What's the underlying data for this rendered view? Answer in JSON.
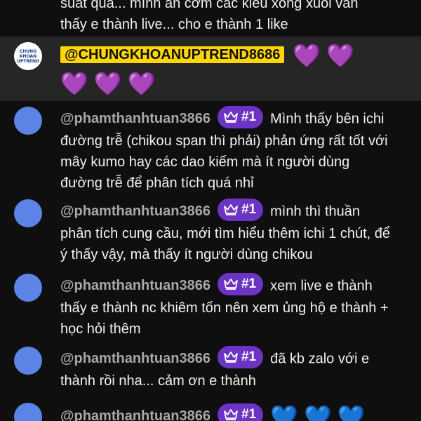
{
  "messages": [
    {
      "text_line1": "suất quá... mình ăn cơm các kiểu xong xuôi vẫn",
      "text_line2": "thấy e thành live... cho e thành 1 like"
    },
    {
      "author": "@CHUNGKHOANUPTREND8686",
      "avatar_logo_text": "CHUNG KHOAN UPTREND",
      "hearts": [
        "purple-heart",
        "purple-heart",
        "purple-heart",
        "purple-heart",
        "purple-heart"
      ],
      "heart_char": "💜",
      "highlighted": true
    },
    {
      "author": "@phamthanhtuan3866",
      "badge": "#1",
      "text": "Mình thấy bên ichi đường trễ (chikou span thì phải) phản ứng rất tốt với mây kumo hay các dao kiếm mà ít người dùng đường trễ để phân tích quá nhỉ"
    },
    {
      "author": "@phamthanhtuan3866",
      "badge": "#1",
      "text": "mình thì thuần phân tích cung cầu, mới tìm hiểu thêm ichi 1 chút, để ý thấy vậy, mà thấy ít người dùng chikou"
    },
    {
      "author": "@phamthanhtuan3866",
      "badge": "#1",
      "text": "xem live e thành thấy e thành nc khiêm tốn nên xem ủng hộ e thành + học hỏi thêm"
    },
    {
      "author": "@phamthanhtuan3866",
      "badge": "#1",
      "text": "đã kb zalo với e thành rồi nha... cảm ơn e thành"
    },
    {
      "author": "@phamthanhtuan3866",
      "badge": "#1",
      "hearts": [
        "blue-heart",
        "blue-heart",
        "blue-heart"
      ],
      "heart_char": "💙"
    }
  ],
  "colors": {
    "background": "#0f0f0f",
    "highlight_row": "#262626",
    "author_chip": "#ffd600",
    "badge": "#6b34c4",
    "avatar": "#5b84e6"
  }
}
